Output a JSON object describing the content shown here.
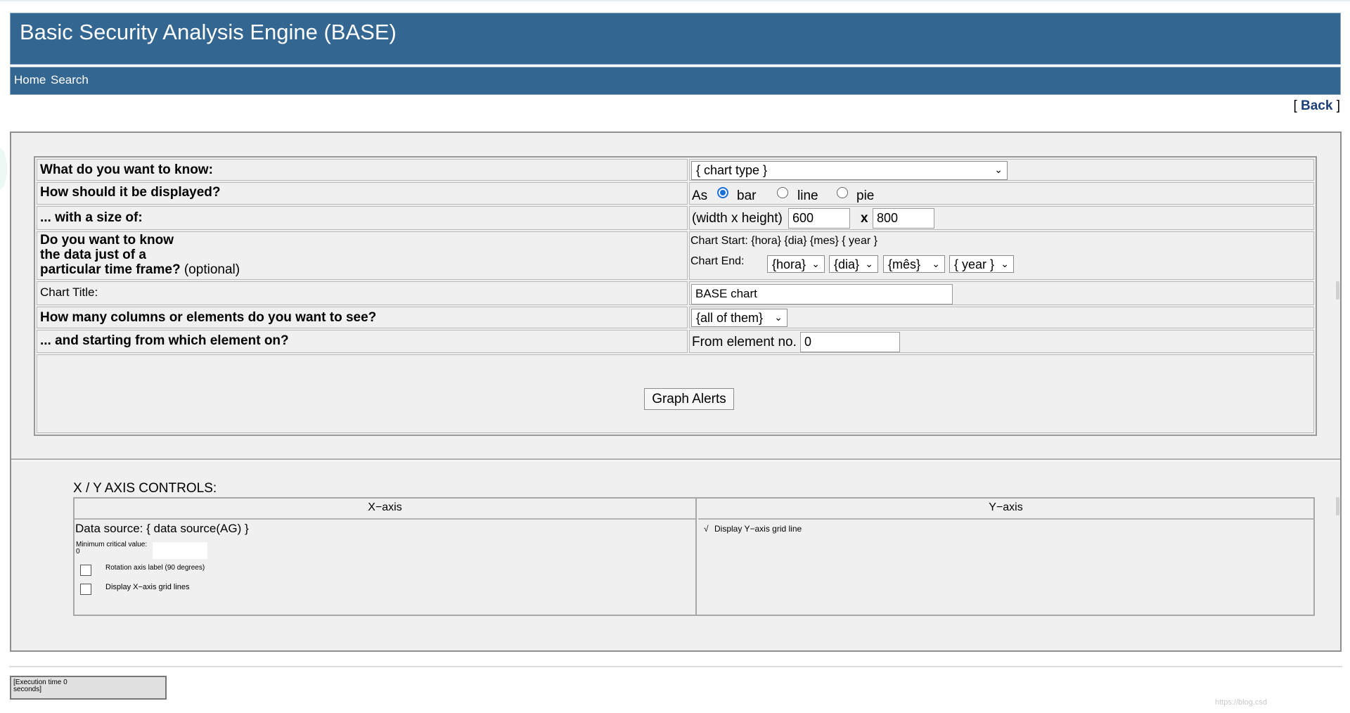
{
  "app": {
    "title": "Basic Security Analysis Engine (BASE)"
  },
  "nav": {
    "home": "Home",
    "search": "Search"
  },
  "back": {
    "open": "[",
    "label": "Back",
    "close": "]"
  },
  "form": {
    "q_know": "What do you want to know:",
    "chart_type": "{ chart type }",
    "q_display": "How should it be displayed?",
    "as_label": "As",
    "opt_bar": "bar",
    "opt_line": "line",
    "opt_pie": "pie",
    "display_selected": "bar",
    "q_size": "... with a size of:",
    "size_label": "(width x height)",
    "width": "600",
    "x_sep": "x",
    "height": "800",
    "q_time_1": "Do you want to know",
    "q_time_2": "the data just of a",
    "q_time_3": "particular time frame?",
    "optional": "(optional)",
    "chart_start": "Chart Start: {hora} {dia} {mes} { year }",
    "chart_end_label": "Chart End:",
    "end_hora": "{hora}",
    "end_dia": "{dia}",
    "end_mes": "{mês}",
    "end_year": "{ year }",
    "chart_title_label": "Chart Title:",
    "chart_title_value": "BASE chart",
    "q_columns": "How many columns or elements do you want to see?",
    "columns_value": "{all of them}",
    "q_start": "... and starting from which element on?",
    "from_element_label": "From element no.",
    "from_element_value": "0",
    "submit": "Graph Alerts"
  },
  "axis": {
    "heading": "X / Y AXIS CONTROLS:",
    "x_header": "X−axis",
    "y_header": "Y−axis",
    "data_source": "Data source: { data source(AG) }",
    "min_critical_label": "Minimum critical value:",
    "min_critical_value": "0",
    "rotation_label": "Rotation axis label (90 degrees)",
    "x_grid_label": "Display X−axis grid lines",
    "y_grid_check": "√",
    "y_grid_label": "Display Y−axis grid line"
  },
  "footer": {
    "exec_1": "[Execution time 0",
    "exec_2": "seconds]",
    "watermark": "https://blog.csd"
  },
  "colors": {
    "header_bg": "#346692",
    "panel_bg": "#f0f0f0",
    "radio_accent": "#1a6fd8",
    "link": "#1d3f7a"
  }
}
